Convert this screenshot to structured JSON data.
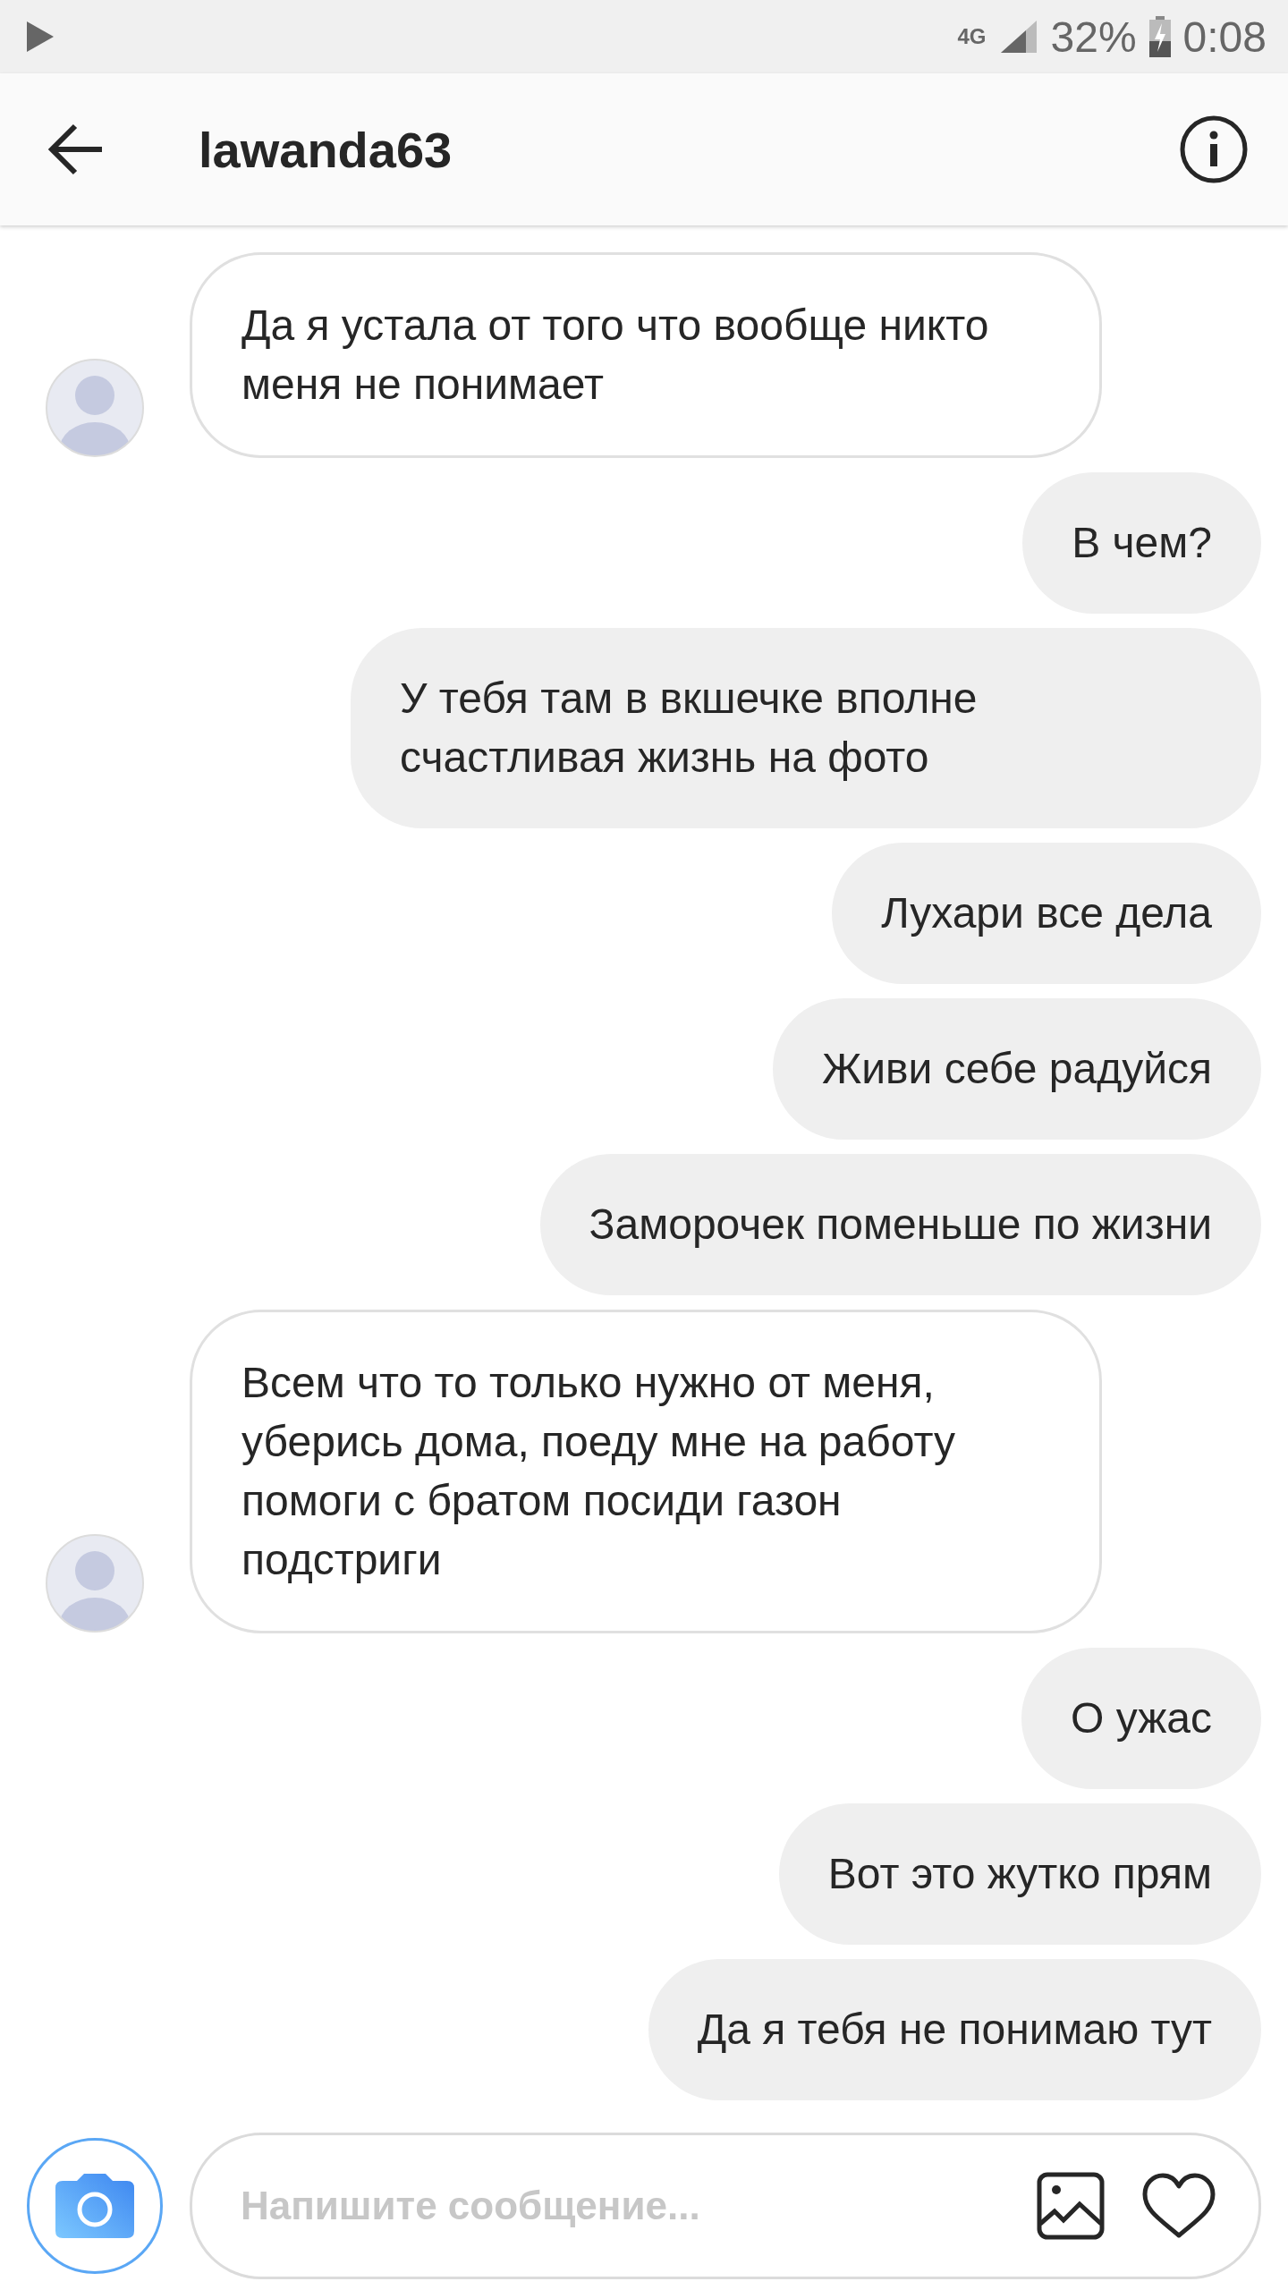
{
  "status_bar": {
    "network": "4G",
    "battery": "32%",
    "time": "0:08"
  },
  "header": {
    "title": "lawanda63"
  },
  "messages": [
    {
      "kind": "incoming",
      "text": "Да я устала от того что вообще никто меня не понимает"
    },
    {
      "kind": "outgoing",
      "text": "В чем?"
    },
    {
      "kind": "outgoing",
      "text": "У тебя там в вкшечке вполне счастливая жизнь на фото"
    },
    {
      "kind": "outgoing",
      "text": "Лухари все дела"
    },
    {
      "kind": "outgoing",
      "text": "Живи себе радуйся"
    },
    {
      "kind": "outgoing",
      "text": "Заморочек поменьше по жизни"
    },
    {
      "kind": "incoming",
      "text": "Всем что то только нужно от меня, уберись дома, поеду мне на работу помоги с братом посиди газон подстриги"
    },
    {
      "kind": "outgoing",
      "text": "О ужас"
    },
    {
      "kind": "outgoing",
      "text": "Вот это жутко прям"
    },
    {
      "kind": "outgoing",
      "text": "Да я тебя не понимаю тут"
    }
  ],
  "composer": {
    "placeholder": "Напишите сообщение..."
  }
}
